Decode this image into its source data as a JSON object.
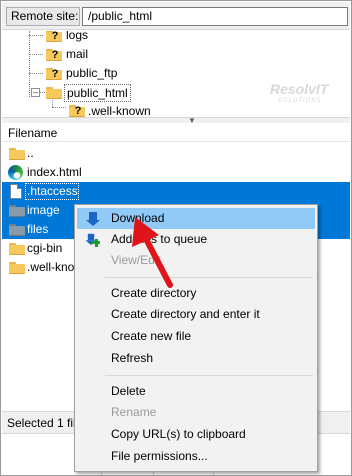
{
  "remote_site": {
    "label": "Remote site:",
    "path": "/public_html"
  },
  "tree": {
    "items": [
      {
        "label": "logs",
        "icon": "folder-question-icon"
      },
      {
        "label": "mail",
        "icon": "folder-question-icon"
      },
      {
        "label": "public_ftp",
        "icon": "folder-question-icon"
      },
      {
        "label": "public_html",
        "icon": "folder-open-icon",
        "selected": true
      },
      {
        "label": ".well-known",
        "icon": "folder-question-icon"
      }
    ]
  },
  "watermark": {
    "text": "ResolvIT",
    "sub": "SOLUTIONS"
  },
  "file_list": {
    "header": "Filename",
    "sort_icon": "chevron-down-icon",
    "rows": [
      {
        "name": "..",
        "icon": "folder-icon",
        "selected": false
      },
      {
        "name": "index.html",
        "icon": "edge-browser-icon",
        "selected": false
      },
      {
        "name": ".htaccess",
        "icon": "document-icon",
        "selected": true
      },
      {
        "name": "image",
        "icon": "folder-icon",
        "selected": true
      },
      {
        "name": "files",
        "icon": "folder-icon",
        "selected": true
      },
      {
        "name": "cgi-bin",
        "icon": "folder-icon",
        "selected": false
      },
      {
        "name": ".well-kno",
        "icon": "folder-icon",
        "selected": false
      }
    ]
  },
  "context_menu": {
    "items": [
      {
        "label": "Download",
        "icon": "download-arrow-icon",
        "hover": true
      },
      {
        "label": "Add files to queue",
        "icon": "add-to-queue-icon"
      },
      {
        "label": "View/Edit",
        "disabled": true
      },
      {
        "label": "Create directory"
      },
      {
        "label": "Create directory and enter it"
      },
      {
        "label": "Create new file"
      },
      {
        "label": "Refresh"
      },
      {
        "label": "Delete"
      },
      {
        "label": "Rename",
        "disabled": true
      },
      {
        "label": "Copy URL(s) to clipboard"
      },
      {
        "label": "File permissions..."
      }
    ]
  },
  "status_bar": {
    "text": "Selected 1 fil"
  },
  "colors": {
    "selection": "#0078d7",
    "menu_hover": "#91c9f7",
    "annotation_arrow": "#e0141b"
  }
}
